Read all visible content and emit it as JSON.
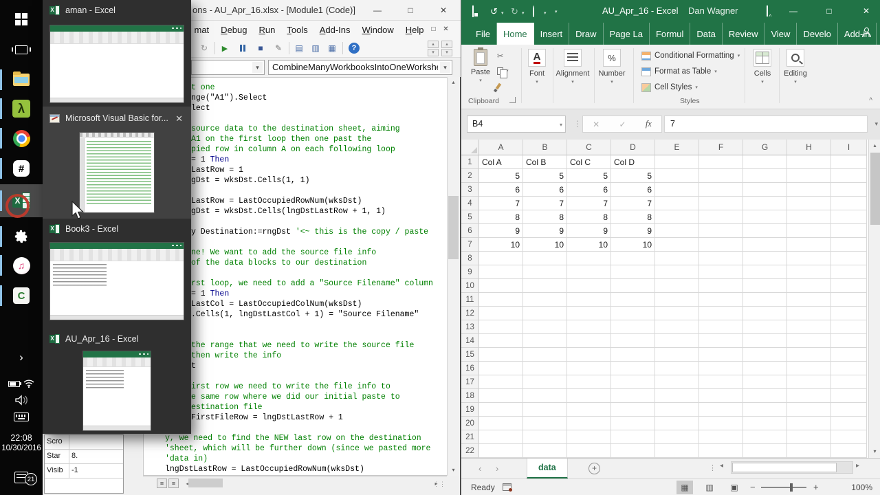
{
  "icons": {
    "dropdown": "▾",
    "close": "✕",
    "minimize": "—",
    "maximize": "□",
    "mdi_minimize": "_",
    "mdi_restore": "□",
    "mdi_close": "✕",
    "play": "▶",
    "stop": "■",
    "design_mode": "✎",
    "project_explorer": "▤",
    "properties_window": "▥",
    "object_browser": "▦",
    "help": "?",
    "redo": "↻",
    "undo": "↺",
    "up": "▴",
    "down": "▾",
    "left": "◂",
    "right": "▸",
    "nav_left": "‹",
    "nav_right": "›",
    "enter": "✓",
    "cancel": "✕",
    "scissors": "✂",
    "font": "A",
    "percent": "%",
    "view_normal": "▦",
    "view_layout": "▥",
    "view_break": "▣",
    "lambda": "λ",
    "hash": "#",
    "music_note": "♫",
    "camtasia": "C",
    "expand_chevron": "›",
    "ellipsis": "⋮",
    "zoom_in": "+",
    "zoom_out": "−",
    "new_sheet": "+",
    "collapse_ribbon": "^",
    "view_lines": "≡",
    "grip": "⋮⋮"
  },
  "taskbar": {
    "clock_time": "22:08",
    "clock_date": "10/30/2016",
    "notification_count": "21"
  },
  "popup": {
    "items": [
      {
        "label": "aman - Excel"
      },
      {
        "label": "Microsoft Visual Basic for..."
      },
      {
        "label": "Book3 - Excel"
      },
      {
        "label": "AU_Apr_16 - Excel"
      }
    ]
  },
  "vba": {
    "window_title": "ons - AU_Apr_16.xlsx - [Module1 (Code)]",
    "menu": [
      {
        "label": "mat",
        "accel": false
      },
      {
        "label": "Debug",
        "accel": true
      },
      {
        "label": "Run",
        "accel": true
      },
      {
        "label": "Tools",
        "accel": true
      },
      {
        "label": "Add-Ins",
        "accel": true
      },
      {
        "label": "Window",
        "accel": true
      },
      {
        "label": "Help",
        "accel": true
      }
    ],
    "procedure_combo": "CombineManyWorkbooksIntoOneWorkshe",
    "properties_rows": [
      {
        "name": "Scro",
        "value": ""
      },
      {
        "name": "Star",
        "value": "8."
      },
      {
        "name": "Visib",
        "value": "-1"
      }
    ],
    "code_main": [
      {
        "segs": [
          [
            "t one",
            "c"
          ]
        ]
      },
      {
        "segs": [
          [
            "nge(\"A1\").Select",
            "n"
          ]
        ]
      },
      {
        "segs": [
          [
            "lect",
            "n"
          ]
        ]
      },
      {
        "segs": []
      },
      {
        "segs": [
          [
            "source data to the destination sheet, aiming",
            "c"
          ]
        ]
      },
      {
        "segs": [
          [
            "A1 on the first loop then one past the",
            "c"
          ]
        ]
      },
      {
        "segs": [
          [
            "pied row in column A on each following loop",
            "c"
          ]
        ]
      },
      {
        "segs": [
          [
            "= 1 ",
            "n"
          ],
          [
            "Then",
            "k"
          ]
        ]
      },
      {
        "segs": [
          [
            "LastRow = 1",
            "n"
          ]
        ]
      },
      {
        "segs": [
          [
            "gDst = wksDst.Cells(1, 1)",
            "n"
          ]
        ]
      },
      {
        "segs": []
      },
      {
        "segs": [
          [
            "LastRow = LastOccupiedRowNum(wksDst)",
            "n"
          ]
        ]
      },
      {
        "segs": [
          [
            "gDst = wksDst.Cells(lngDstLastRow + 1, 1)",
            "n"
          ]
        ]
      },
      {
        "segs": []
      },
      {
        "segs": [
          [
            "y Destination:=rngDst ",
            "n"
          ],
          [
            "'<~ this is the copy / paste",
            "c"
          ]
        ]
      },
      {
        "segs": []
      },
      {
        "segs": [
          [
            "ne! We want to add the source file info",
            "c"
          ]
        ]
      },
      {
        "segs": [
          [
            "of the data blocks to our destination",
            "c"
          ]
        ]
      },
      {
        "segs": []
      },
      {
        "segs": [
          [
            "rst loop, we need to add a \"Source Filename\" column",
            "c"
          ]
        ]
      },
      {
        "segs": [
          [
            "= 1 ",
            "n"
          ],
          [
            "Then",
            "k"
          ]
        ]
      },
      {
        "segs": [
          [
            "LastCol = LastOccupiedColNum(wksDst)",
            "n"
          ]
        ]
      },
      {
        "segs": [
          [
            ".Cells(1, lngDstLastCol + 1) = \"Source Filename\"",
            "n"
          ]
        ]
      },
      {
        "segs": []
      },
      {
        "segs": []
      },
      {
        "segs": [
          [
            "the range that we need to write the source file",
            "c"
          ]
        ]
      },
      {
        "segs": [
          [
            "then write the info",
            "c"
          ]
        ]
      },
      {
        "segs": [
          [
            "t",
            "n"
          ]
        ]
      },
      {
        "segs": []
      },
      {
        "segs": [
          [
            "irst row we need to write the file info to",
            "c"
          ]
        ]
      },
      {
        "segs": [
          [
            "e same row where we did our initial paste to",
            "c"
          ]
        ]
      },
      {
        "segs": [
          [
            "estination file",
            "c"
          ]
        ]
      },
      {
        "segs": [
          [
            "FirstFileRow = lngDstLastRow + 1",
            "n"
          ]
        ]
      }
    ],
    "code_bottom": [
      {
        "segs": [
          [
            "y, we need to find the NEW last row on the destination",
            "c"
          ]
        ]
      },
      {
        "segs": [
          [
            "'sheet, which will be further down (since we pasted more",
            "c"
          ]
        ]
      },
      {
        "segs": [
          [
            "'data in)",
            "c"
          ]
        ]
      },
      {
        "segs": [
          [
            "lngDstLastRow = LastOccupiedRowNum(wksDst)",
            "n"
          ]
        ]
      }
    ]
  },
  "excel": {
    "title": "AU_Apr_16  -  Excel",
    "user": "Dan Wagner",
    "ribbon_tabs": [
      "File",
      "Home",
      "Insert",
      "Draw",
      "Page La",
      "Formul",
      "Data",
      "Review",
      "View",
      "Develo",
      "Add-in"
    ],
    "tell_me": "Tell me",
    "ribbon": {
      "paste": "Paste",
      "clipboard": "Clipboard",
      "font": "Font",
      "alignment": "Alignment",
      "number": "Number",
      "conditional_formatting": "Conditional Formatting",
      "format_as_table": "Format as Table",
      "cell_styles": "Cell Styles",
      "styles": "Styles",
      "cells": "Cells",
      "editing": "Editing"
    },
    "name_box": "B4",
    "formula_bar_value": "7",
    "fx_label": "fx",
    "columns": [
      "A",
      "B",
      "C",
      "D",
      "E",
      "F",
      "G",
      "H",
      "I"
    ],
    "row_count": 22,
    "sheet_data": {
      "1": [
        "Col A",
        "Col B",
        "Col C",
        "Col D"
      ],
      "2": [
        "5",
        "5",
        "5",
        "5"
      ],
      "3": [
        "6",
        "6",
        "6",
        "6"
      ],
      "4": [
        "7",
        "7",
        "7",
        "7"
      ],
      "5": [
        "8",
        "8",
        "8",
        "8"
      ],
      "6": [
        "9",
        "9",
        "9",
        "9"
      ],
      "7": [
        "10",
        "10",
        "10",
        "10"
      ]
    },
    "sheet_tab": "data",
    "status_ready": "Ready",
    "zoom_level": "100%"
  }
}
